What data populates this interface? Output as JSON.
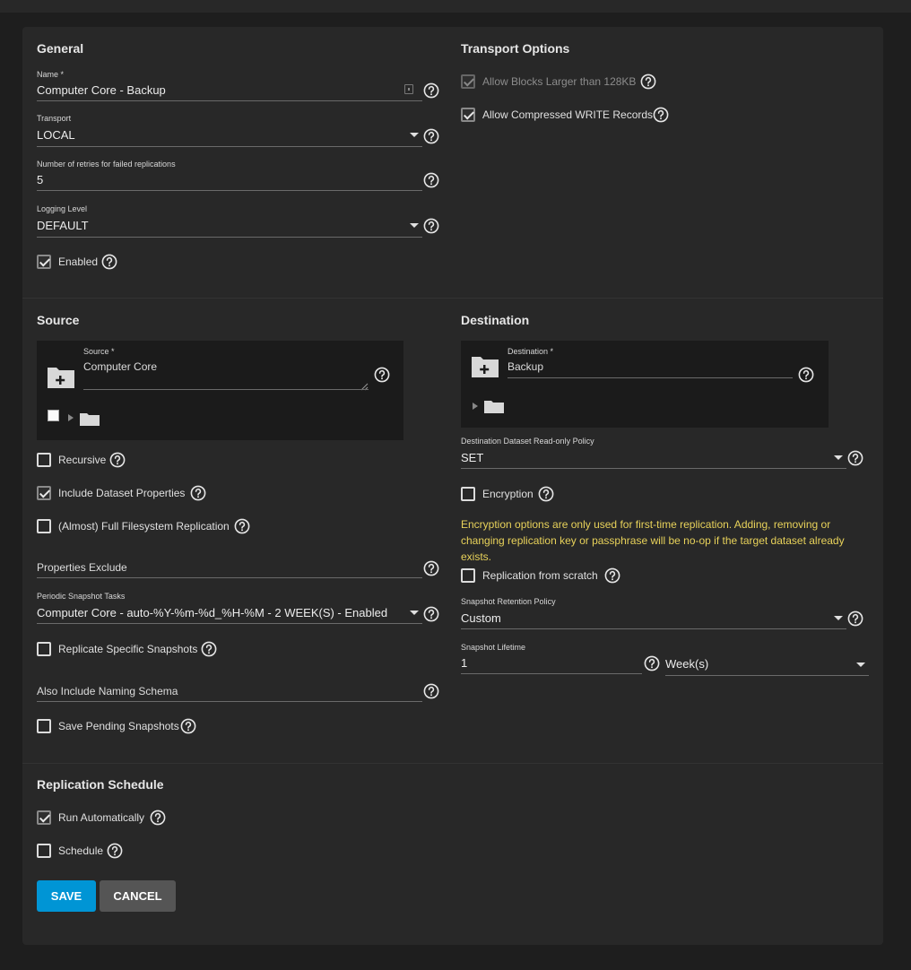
{
  "general": {
    "title": "General",
    "name": {
      "label": "Name *",
      "value": "Computer Core - Backup"
    },
    "transport": {
      "label": "Transport",
      "value": "LOCAL"
    },
    "retries": {
      "label": "Number of retries for failed replications",
      "value": "5"
    },
    "logging": {
      "label": "Logging Level",
      "value": "DEFAULT"
    },
    "enabled": {
      "label": "Enabled",
      "checked": true
    }
  },
  "transport_options": {
    "title": "Transport Options",
    "large_blocks": {
      "label": "Allow Blocks Larger than 128KB",
      "checked": true,
      "disabled": true
    },
    "compressed": {
      "label": "Allow Compressed WRITE Records",
      "checked": true
    }
  },
  "source": {
    "title": "Source",
    "field_label": "Source *",
    "field_value": "Computer Core",
    "recursive": {
      "label": "Recursive",
      "checked": false
    },
    "include_props": {
      "label": "Include Dataset Properties",
      "checked": true
    },
    "full_fs": {
      "label": "(Almost) Full Filesystem Replication",
      "checked": false
    },
    "properties_exclude": {
      "placeholder": "Properties Exclude"
    },
    "periodic": {
      "label": "Periodic Snapshot Tasks",
      "value": "Computer Core - auto-%Y-%m-%d_%H-%M - 2 WEEK(S) - Enabled"
    },
    "replicate_specific": {
      "label": "Replicate Specific Snapshots",
      "checked": false
    },
    "naming_schema": {
      "placeholder": "Also Include Naming Schema"
    },
    "save_pending": {
      "label": "Save Pending Snapshots",
      "checked": false
    }
  },
  "destination": {
    "title": "Destination",
    "field_label": "Destination *",
    "field_value": "Backup",
    "readonly_policy": {
      "label": "Destination Dataset Read-only Policy",
      "value": "SET"
    },
    "encryption": {
      "label": "Encryption",
      "checked": false
    },
    "warning": "Encryption options are only used for first-time replication. Adding, removing or changing replication key or passphrase will be no-op if the target dataset already exists.",
    "from_scratch": {
      "label": "Replication from scratch",
      "checked": false
    },
    "retention": {
      "label": "Snapshot Retention Policy",
      "value": "Custom"
    },
    "lifetime": {
      "label": "Snapshot Lifetime",
      "value": "1",
      "unit": "Week(s)"
    }
  },
  "schedule": {
    "title": "Replication Schedule",
    "run_auto": {
      "label": "Run Automatically",
      "checked": true
    },
    "schedule": {
      "label": "Schedule",
      "checked": false
    }
  },
  "actions": {
    "save": "SAVE",
    "cancel": "CANCEL"
  },
  "colors": {
    "accent": "#0095d5",
    "warning": "#e8d25a",
    "card": "#282828",
    "background": "#1e1e1e"
  }
}
